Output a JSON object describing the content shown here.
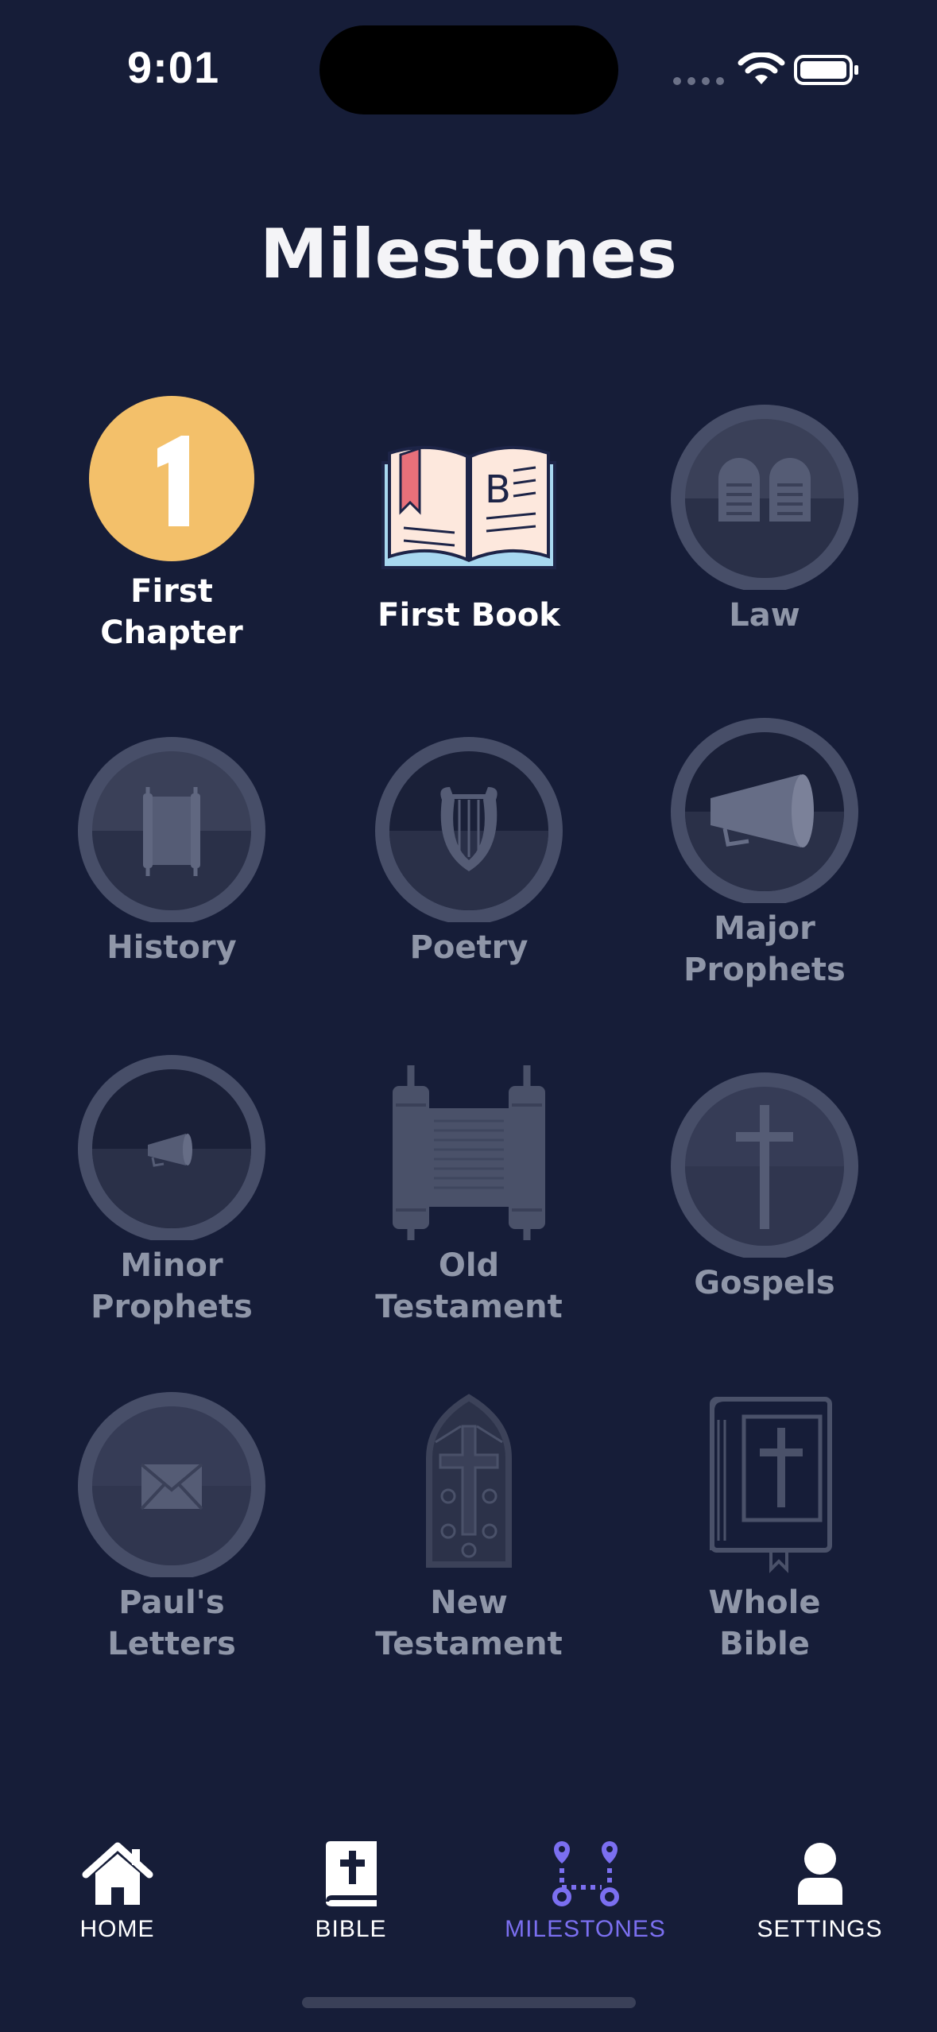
{
  "status_bar": {
    "time": "9:01"
  },
  "title": "Milestones",
  "milestones": [
    {
      "label": "First\nChapter",
      "icon": "number-one-icon",
      "achieved": true
    },
    {
      "label": "First Book",
      "icon": "open-book-icon",
      "achieved": true
    },
    {
      "label": "Law",
      "icon": "stone-tablets-icon",
      "achieved": false
    },
    {
      "label": "History",
      "icon": "scroll-icon",
      "achieved": false
    },
    {
      "label": "Poetry",
      "icon": "lyre-icon",
      "achieved": false
    },
    {
      "label": "Major\nProphets",
      "icon": "megaphone-icon",
      "achieved": false
    },
    {
      "label": "Minor\nProphets",
      "icon": "small-megaphone-icon",
      "achieved": false
    },
    {
      "label": "Old\nTestament",
      "icon": "torah-scroll-icon",
      "achieved": false
    },
    {
      "label": "Gospels",
      "icon": "cross-icon",
      "achieved": false
    },
    {
      "label": "Paul's\nLetters",
      "icon": "envelope-icon",
      "achieved": false
    },
    {
      "label": "New\nTestament",
      "icon": "stained-glass-window-icon",
      "achieved": false
    },
    {
      "label": "Whole\nBible",
      "icon": "bible-book-icon",
      "achieved": false
    }
  ],
  "tabs": [
    {
      "label": "HOME",
      "icon": "home-icon",
      "active": false
    },
    {
      "label": "BIBLE",
      "icon": "bible-icon",
      "active": false
    },
    {
      "label": "MILESTONES",
      "icon": "milestones-icon",
      "active": true
    },
    {
      "label": "SETTINGS",
      "icon": "user-icon",
      "active": false
    }
  ],
  "colors": {
    "background": "#161d38",
    "achieved_gold": "#f3c06a",
    "locked_badge": "#474e68",
    "active_tab": "#7b6ff0"
  }
}
